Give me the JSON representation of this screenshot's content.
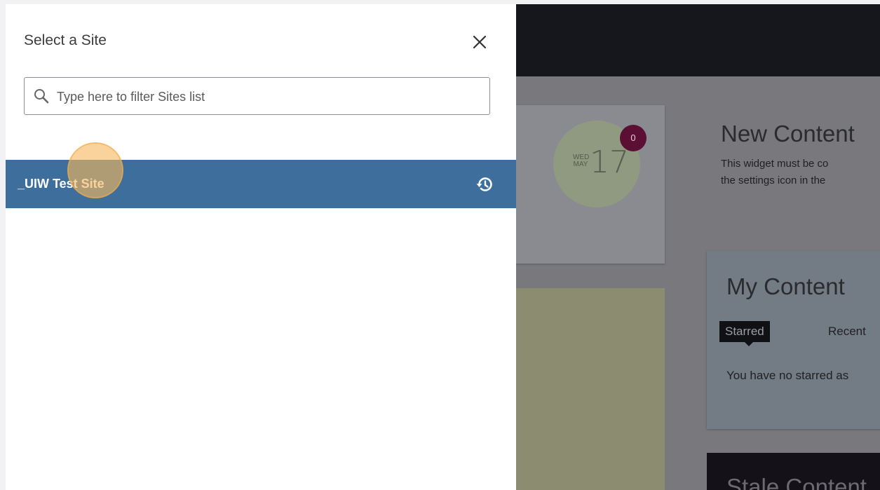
{
  "drawer": {
    "title": "Select a Site",
    "close_icon": "close-icon",
    "search": {
      "placeholder": "Type here to filter Sites list",
      "value": "",
      "icon": "search-icon"
    },
    "sites": [
      {
        "label": "_UIW Test Site",
        "icon": "history-icon",
        "selected": true
      }
    ]
  },
  "background": {
    "calendar": {
      "day": "WED",
      "month": "MAY",
      "date": "17",
      "badge": "0"
    },
    "new_content": {
      "title": "New Content",
      "desc_line1": "This widget must be co",
      "desc_line2": "the settings icon in the"
    },
    "my_content": {
      "title": "My Content",
      "tabs": [
        "Starred",
        "Recent"
      ],
      "empty_text": "You have no starred as"
    },
    "stale_content": {
      "title": "Stale Content"
    }
  },
  "colors": {
    "selected_row": "#3e6f9c",
    "topbar": "#16171c",
    "badge": "#5c0f35",
    "click_marker": "#f5b85e"
  }
}
